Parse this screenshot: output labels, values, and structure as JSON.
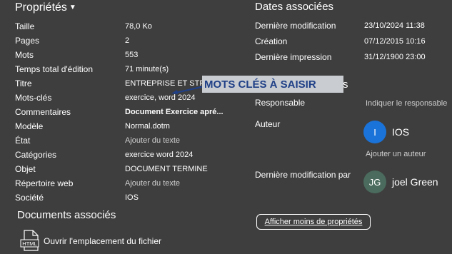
{
  "left": {
    "title": "Propriétés",
    "properties": [
      {
        "label": "Taille",
        "value": "78,0 Ko",
        "style": "normal"
      },
      {
        "label": "Pages",
        "value": "2",
        "style": "normal"
      },
      {
        "label": "Mots",
        "value": "553",
        "style": "normal"
      },
      {
        "label": "Temps total d'édition",
        "value": "71 minute(s)",
        "style": "normal"
      },
      {
        "label": "Titre",
        "value": "ENTREPRISE ET STRUC",
        "style": "normal"
      },
      {
        "label": "Mots-clés",
        "value": "exercice, word 2024",
        "style": "normal"
      },
      {
        "label": "Commentaires",
        "value": "Document Exercice apré...",
        "style": "bold"
      },
      {
        "label": "Modèle",
        "value": "Normal.dotm",
        "style": "normal"
      },
      {
        "label": "État",
        "value": "Ajouter du texte",
        "style": "muted"
      },
      {
        "label": "Catégories",
        "value": "exercice word 2024",
        "style": "normal"
      },
      {
        "label": "Objet",
        "value": "DOCUMENT TERMINE",
        "style": "normal"
      },
      {
        "label": "Répertoire web",
        "value": "Ajouter du texte",
        "style": "muted"
      },
      {
        "label": "Société",
        "value": "IOS",
        "style": "normal"
      }
    ],
    "related_docs_title": "Documents associés",
    "open_location": "Ouvrir l'emplacement du fichier",
    "html_icon_text": "HTML"
  },
  "right": {
    "dates_title": "Dates associées",
    "dates": [
      {
        "label": "Dernière modification",
        "value": "23/10/2024 11:38"
      },
      {
        "label": "Création",
        "value": "07/12/2015 10:16"
      },
      {
        "label": "Dernière impression",
        "value": "31/12/1900 23:00"
      }
    ],
    "people_title_fragment": "s",
    "responsable_label": "Responsable",
    "responsable_value": "Indiquer le responsable",
    "auteur_label": "Auteur",
    "author_initial": "I",
    "author_name": "IOS",
    "add_author": "Ajouter un auteur",
    "last_modified_by_label": "Dernière modification par",
    "modifier_initials": "JG",
    "modifier_name": "joel Green",
    "show_less": "Afficher moins de propriétés"
  },
  "overlay": {
    "banner_text": "MOTS CLÉS À SAISIR"
  },
  "colors": {
    "background": "#3e3e3e",
    "author_avatar": "#1a73d9",
    "modifier_avatar": "#4a6b5d",
    "banner_bg": "#c9cdd2",
    "banner_text": "#1f3f86"
  }
}
